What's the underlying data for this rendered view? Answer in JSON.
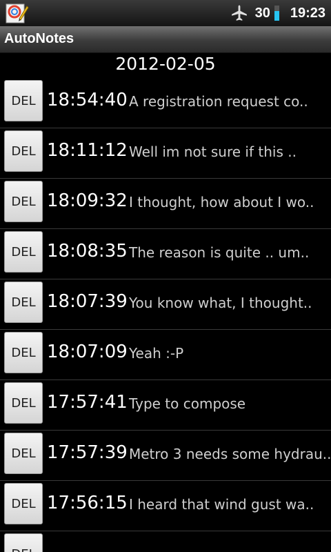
{
  "status_bar": {
    "battery_level": "30",
    "time": "19:23",
    "icons": [
      "autonotes-app-icon",
      "airplane-mode-icon",
      "battery-icon"
    ]
  },
  "app": {
    "title": "AutoNotes"
  },
  "date_header": "2012-02-05",
  "notes": [
    {
      "delete_label": "DEL",
      "time": "18:54:40",
      "preview": "A registration request co.."
    },
    {
      "delete_label": "DEL",
      "time": "18:11:12",
      "preview": "Well im not sure if this .."
    },
    {
      "delete_label": "DEL",
      "time": "18:09:32",
      "preview": "I thought, how about I wo.."
    },
    {
      "delete_label": "DEL",
      "time": "18:08:35",
      "preview": "The reason is quite .. um.."
    },
    {
      "delete_label": "DEL",
      "time": "18:07:39",
      "preview": "You know what,  I thought.."
    },
    {
      "delete_label": "DEL",
      "time": "18:07:09",
      "preview": "Yeah :-P"
    },
    {
      "delete_label": "DEL",
      "time": "17:57:41",
      "preview": "Type to compose"
    },
    {
      "delete_label": "DEL",
      "time": "17:57:39",
      "preview": "Metro 3 needs some hydrau.."
    },
    {
      "delete_label": "DEL",
      "time": "17:56:15",
      "preview": "I heard that wind gust wa.."
    }
  ],
  "partial_note": {
    "delete_label": "DEL"
  },
  "colors": {
    "background": "#000000",
    "battery_fill": "#27c4f2",
    "divider": "#3a3a3a"
  }
}
